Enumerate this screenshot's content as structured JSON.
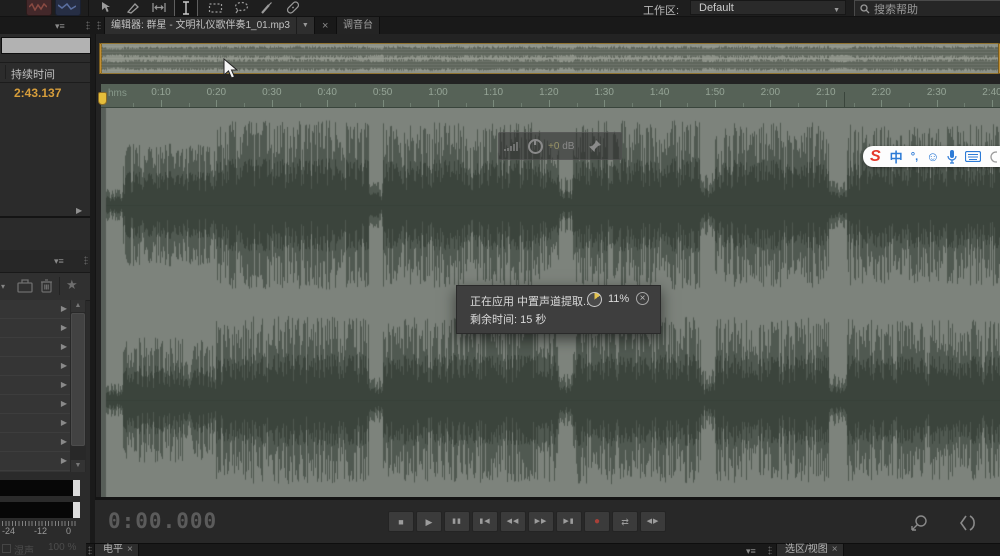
{
  "toolbar": {
    "workspace_label": "工作区:",
    "workspace_value": "Default",
    "search_placeholder": "搜索帮助"
  },
  "tabs": {
    "editor": "编辑器: 群星 - 文明礼仪歌伴奏1_01.mp3",
    "mixer": "调音台",
    "close_glyph": "×"
  },
  "left_panel": {
    "duration_label": "持续时间",
    "duration_value": "2:43.137",
    "meter_scale": [
      "-24",
      "-12",
      "0"
    ],
    "wet_label": "湿声",
    "wet_value": "100 %"
  },
  "ruler": {
    "unit_label": "hms",
    "ticks": [
      "0:10",
      "0:20",
      "0:30",
      "0:40",
      "0:50",
      "1:00",
      "1:10",
      "1:20",
      "1:30",
      "1:40",
      "1:50",
      "2:00",
      "2:10",
      "2:20",
      "2:30",
      "2:40"
    ]
  },
  "effects_rack": {
    "row_count": 9
  },
  "hud": {
    "gain_value": "+0",
    "gain_unit": "dB"
  },
  "progress_dialog": {
    "message": "正在应用 中置声道提取...",
    "percent": "11%",
    "remaining": "剩余时间: 15 秒"
  },
  "transport": {
    "time_display": "0:00.000",
    "buttons": [
      {
        "name": "stop",
        "glyph": "■"
      },
      {
        "name": "play",
        "glyph": "▶"
      },
      {
        "name": "pause",
        "glyph": "▮▮"
      },
      {
        "name": "go-to-start",
        "glyph": "▮◀"
      },
      {
        "name": "rewind",
        "glyph": "◀◀"
      },
      {
        "name": "fast-forward",
        "glyph": "▶▶"
      },
      {
        "name": "go-to-end",
        "glyph": "▶▮"
      },
      {
        "name": "record",
        "glyph": "●"
      },
      {
        "name": "loop-playback",
        "glyph": "⇄"
      },
      {
        "name": "skip-selection",
        "glyph": "◀▶"
      }
    ]
  },
  "bottom_tabs": {
    "levels": "电平",
    "selection_view": "选区/视图",
    "close_glyph": "×"
  },
  "ime": {
    "logo": "S",
    "mode": "中",
    "punctuation": "°,",
    "smiley": "☺"
  },
  "colors": {
    "accent_orange": "#d79e3b",
    "waveform_bg": "#7d837c",
    "ruler_bg": "#566257",
    "dialog_bg": "#3e3e3e",
    "ime_blue": "#2d7bd6",
    "record_red": "#a84038"
  }
}
